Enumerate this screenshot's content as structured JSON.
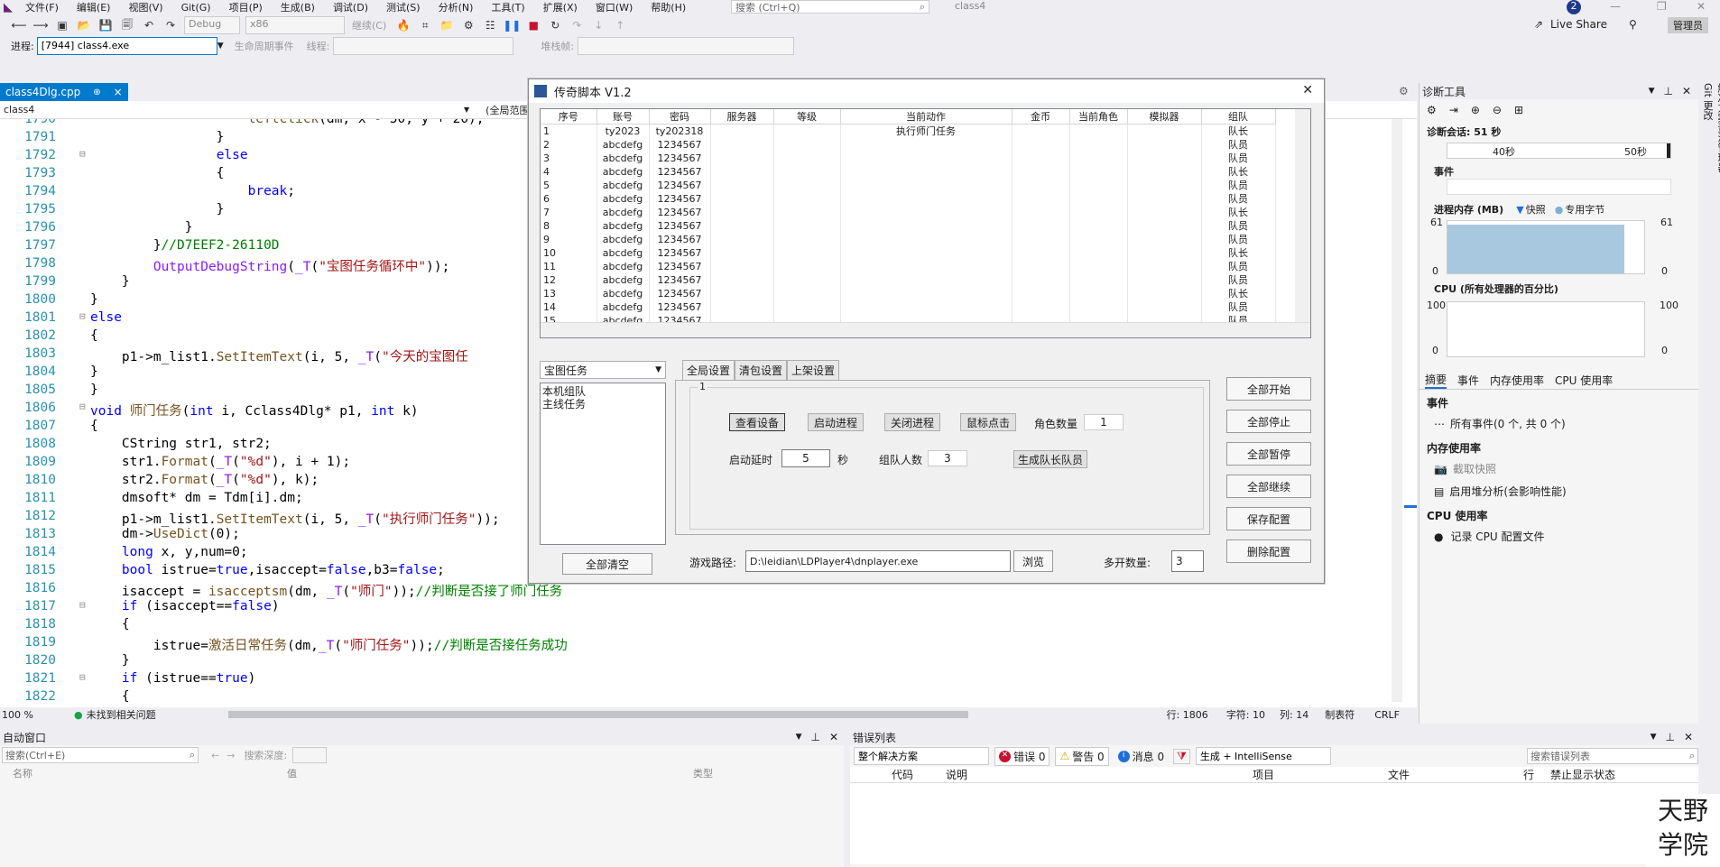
{
  "menu": [
    "文件(F)",
    "编辑(E)",
    "视图(V)",
    "Git(G)",
    "项目(P)",
    "生成(B)",
    "调试(D)",
    "测试(S)",
    "分析(N)",
    "工具(T)",
    "扩展(X)",
    "窗口(W)",
    "帮助(H)"
  ],
  "search": {
    "placeholder": "搜索 (Ctrl+Q)"
  },
  "solution_name": "class4",
  "notif_count": "2",
  "live_share": "Live Share",
  "admin_badge": "管理员",
  "toolbar": {
    "config": "Debug",
    "platform": "x86",
    "continue": "继续(C)",
    "process_label": "进程:",
    "process_value": "[7944] class4.exe",
    "lifecycle": "生命周期事件",
    "thread": "线程:",
    "stackframe": "堆栈帧:"
  },
  "doc_tab": {
    "name": "class4Dlg.cpp",
    "pin": "⊕",
    "close": "×"
  },
  "nav": {
    "scope": "class4",
    "scope2": "(全局范围"
  },
  "code_lines": [
    {
      "n": "1790",
      "h": "                    <span class='fn'>leftclick</span>(dm, x - 50, y + 20);"
    },
    {
      "n": "1791",
      "h": "                }"
    },
    {
      "n": "1792",
      "h": "                <span class='kw'>else</span>"
    },
    {
      "n": "1793",
      "h": "                {"
    },
    {
      "n": "1794",
      "h": "                    <span class='kw'>break</span>;"
    },
    {
      "n": "1795",
      "h": "                }"
    },
    {
      "n": "1796",
      "h": "            }"
    },
    {
      "n": "1797",
      "h": "        }<span class='cm'>//D7EEF2-26110D</span>"
    },
    {
      "n": "1798",
      "h": "        <span class='mac'>OutputDebugString</span>(<span class='mac'>_T</span>(<span class='str'>\"宝图任务循环中\"</span>));"
    },
    {
      "n": "1799",
      "h": "    }"
    },
    {
      "n": "1800",
      "h": "}"
    },
    {
      "n": "1801",
      "h": "<span class='kw'>else</span>"
    },
    {
      "n": "1802",
      "h": "{"
    },
    {
      "n": "1803",
      "h": "    p1-&gt;m_list1.<span class='fn'>SetItemText</span>(i, 5, <span class='mac'>_T</span>(<span class='str'>\"今天的宝图任</span>"
    },
    {
      "n": "1804",
      "h": "}"
    },
    {
      "n": "1805",
      "h": "}"
    },
    {
      "n": "1806",
      "h": "<span class='kw'>void</span> <span class='fn'>师门任务</span>(<span class='kw'>int</span> i, Cclass4Dlg* p1, <span class='kw'>int</span> k)"
    },
    {
      "n": "1807",
      "h": "{"
    },
    {
      "n": "1808",
      "h": "    CString str1, str2;"
    },
    {
      "n": "1809",
      "h": "    str1.<span class='fn'>Format</span>(<span class='mac'>_T</span>(<span class='str'>\"%d\"</span>), i + 1);"
    },
    {
      "n": "1810",
      "h": "    str2.<span class='fn'>Format</span>(<span class='mac'>_T</span>(<span class='str'>\"%d\"</span>), k);"
    },
    {
      "n": "1811",
      "h": "    dmsoft* dm = Tdm[i].dm;"
    },
    {
      "n": "1812",
      "h": "    p1-&gt;m_list1.<span class='fn'>SetItemText</span>(i, 5, <span class='mac'>_T</span>(<span class='str'>\"执行师门任务\"</span>));"
    },
    {
      "n": "1813",
      "h": "    dm-&gt;<span class='fn'>UseDict</span>(0);"
    },
    {
      "n": "1814",
      "h": "    <span class='kw'>long</span> x, y,num=0;"
    },
    {
      "n": "1815",
      "h": "    <span class='kw'>bool</span> istrue=<span class='kw'>true</span>,isaccept=<span class='kw'>false</span>,b3=<span class='kw'>false</span>;"
    },
    {
      "n": "1816",
      "h": "    isaccept = <span class='fn'>isacceptsm</span>(dm, <span class='mac'>_T</span>(<span class='str'>\"师门\"</span>));<span class='cm'>//判断是否接了师门任务</span>"
    },
    {
      "n": "1817",
      "h": "    <span class='kw'>if</span> (isaccept==<span class='kw'>false</span>)"
    },
    {
      "n": "1818",
      "h": "    {"
    },
    {
      "n": "1819",
      "h": "        istrue=<span class='fn'>激活日常任务</span>(dm,<span class='mac'>_T</span>(<span class='str'>\"师门任务\"</span>));<span class='cm'>//判断是否接任务成功</span>"
    },
    {
      "n": "1820",
      "h": "    }"
    },
    {
      "n": "1821",
      "h": "    <span class='kw'>if</span> (istrue==<span class='kw'>true</span>)"
    },
    {
      "n": "1822",
      "h": "    {"
    }
  ],
  "status": {
    "zoom": "100 %",
    "issues": "未找到相关问题",
    "line": "行: 1806",
    "char": "字符: 10",
    "col": "列: 14",
    "tabs": "制表符",
    "eol": "CRLF"
  },
  "dialog": {
    "title": "传奇脚本 V1.2",
    "columns": [
      "序号",
      "账号",
      "密码",
      "服务器",
      "等级",
      "当前动作",
      "金币",
      "当前角色",
      "模拟器",
      "组队"
    ],
    "rows": [
      [
        "1",
        "ty2023",
        "ty202318",
        "",
        "",
        "执行师门任务",
        "",
        "",
        "",
        "队长"
      ],
      [
        "2",
        "abcdefg",
        "1234567",
        "",
        "",
        "",
        "",
        "",
        "",
        "队员"
      ],
      [
        "3",
        "abcdefg",
        "1234567",
        "",
        "",
        "",
        "",
        "",
        "",
        "队员"
      ],
      [
        "4",
        "abcdefg",
        "1234567",
        "",
        "",
        "",
        "",
        "",
        "",
        "队长"
      ],
      [
        "5",
        "abcdefg",
        "1234567",
        "",
        "",
        "",
        "",
        "",
        "",
        "队员"
      ],
      [
        "6",
        "abcdefg",
        "1234567",
        "",
        "",
        "",
        "",
        "",
        "",
        "队员"
      ],
      [
        "7",
        "abcdefg",
        "1234567",
        "",
        "",
        "",
        "",
        "",
        "",
        "队长"
      ],
      [
        "8",
        "abcdefg",
        "1234567",
        "",
        "",
        "",
        "",
        "",
        "",
        "队员"
      ],
      [
        "9",
        "abcdefg",
        "1234567",
        "",
        "",
        "",
        "",
        "",
        "",
        "队员"
      ],
      [
        "10",
        "abcdefg",
        "1234567",
        "",
        "",
        "",
        "",
        "",
        "",
        "队长"
      ],
      [
        "11",
        "abcdefg",
        "1234567",
        "",
        "",
        "",
        "",
        "",
        "",
        "队员"
      ],
      [
        "12",
        "abcdefg",
        "1234567",
        "",
        "",
        "",
        "",
        "",
        "",
        "队员"
      ],
      [
        "13",
        "abcdefg",
        "1234567",
        "",
        "",
        "",
        "",
        "",
        "",
        "队长"
      ],
      [
        "14",
        "abcdefg",
        "1234567",
        "",
        "",
        "",
        "",
        "",
        "",
        "队员"
      ],
      [
        "15",
        "abcdefg",
        "1234567",
        "",
        "",
        "",
        "",
        "",
        "",
        "队员"
      ]
    ],
    "task_select": "宝图任务",
    "task_list": [
      "本机组队",
      "主线任务"
    ],
    "clear_all": "全部清空",
    "tabs": [
      "全局设置",
      "清包设置",
      "上架设置"
    ],
    "group_label": "1",
    "btn_view_device": "查看设备",
    "btn_start_process": "启动进程",
    "btn_close_process": "关闭进程",
    "btn_mouse_click": "鼠标点击",
    "role_count_label": "角色数量",
    "role_count": "1",
    "start_delay_label": "启动延时",
    "start_delay": "5",
    "sec_unit": "秒",
    "team_size_label": "组队人数",
    "team_size": "3",
    "btn_gen_team": "生成队长队员",
    "game_path_label": "游戏路径:",
    "game_path": "D:\\leidian\\LDPlayer4\\dnplayer.exe",
    "browse": "浏览",
    "multi_label": "多开数量:",
    "multi_count": "3",
    "side_buttons": [
      "全部开始",
      "全部停止",
      "全部暂停",
      "全部继续",
      "保存配置",
      "删除配置"
    ],
    "close": "✕"
  },
  "diag": {
    "title": "诊断工具",
    "session": "诊断会话: 51 秒",
    "t40": "40秒",
    "t50": "50秒",
    "events": "事件",
    "memory": "进程内存 (MB)",
    "snapshot": "快照",
    "private_bytes": "专用字节",
    "mem_max": "61",
    "mem_min": "0",
    "cpu": "CPU (所有处理器的百分比)",
    "cpu_max": "100",
    "cpu_min": "0",
    "tabs": [
      "摘要",
      "事件",
      "内存使用率",
      "CPU 使用率"
    ],
    "ev_head": "事件",
    "ev_all": "所有事件(0 个, 共 0 个)",
    "mem_head": "内存使用率",
    "take_snapshot": "截取快照",
    "heap": "启用堆分析(会影响性能)",
    "cpu_head": "CPU 使用率",
    "cpu_profile": "记录 CPU 配置文件",
    "mem_fill": 0.9
  },
  "right_vtabs": [
    "解决方案资源管理器",
    "Git 更改"
  ],
  "autos": {
    "title": "自动窗口",
    "search": "搜索(Ctrl+E)",
    "depth": "搜索深度:",
    "col_name": "名称",
    "col_value": "值",
    "col_type": "类型"
  },
  "errors": {
    "title": "错误列表",
    "scope": "整个解决方案",
    "err": "错误 0",
    "warn": "警告 0",
    "msg": "消息 0",
    "build": "生成 + IntelliSense",
    "search": "搜索错误列表",
    "cols": [
      "代码",
      "说明",
      "项目",
      "文件",
      "行",
      "禁止显示状态"
    ]
  },
  "watermark": [
    "天野",
    "学院"
  ]
}
